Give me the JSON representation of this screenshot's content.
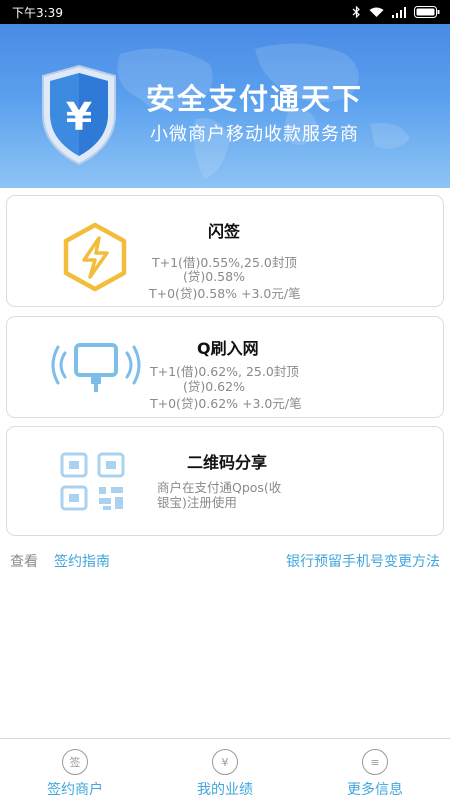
{
  "status_bar": {
    "time": "下午3:39"
  },
  "banner": {
    "shield_symbol": "¥",
    "title": "安全支付通天下",
    "subtitle": "小微商户移动收款服务商"
  },
  "cards": [
    {
      "title": "闪签",
      "lines": [
        "T+1(借)0.55%,25.0封顶",
        "(贷)0.58%",
        "T+0(贷)0.58% +3.0元/笔"
      ]
    },
    {
      "title": "Q刷入网",
      "lines": [
        "T+1(借)0.62%, 25.0封顶",
        "(贷)0.62%",
        "T+0(贷)0.62% +3.0元/笔"
      ]
    },
    {
      "title": "二维码分享",
      "lines": [
        "商户在支付通Qpos(收",
        "银宝)注册使用"
      ]
    }
  ],
  "links": {
    "label": "查看",
    "guide": "签约指南",
    "bank_phone": "银行预留手机号变更方法"
  },
  "bottom_nav": [
    {
      "icon_char": "签",
      "label": "签约商户"
    },
    {
      "icon_char": "¥",
      "label": "我的业绩"
    },
    {
      "icon_char": "≡",
      "label": "更多信息"
    }
  ]
}
